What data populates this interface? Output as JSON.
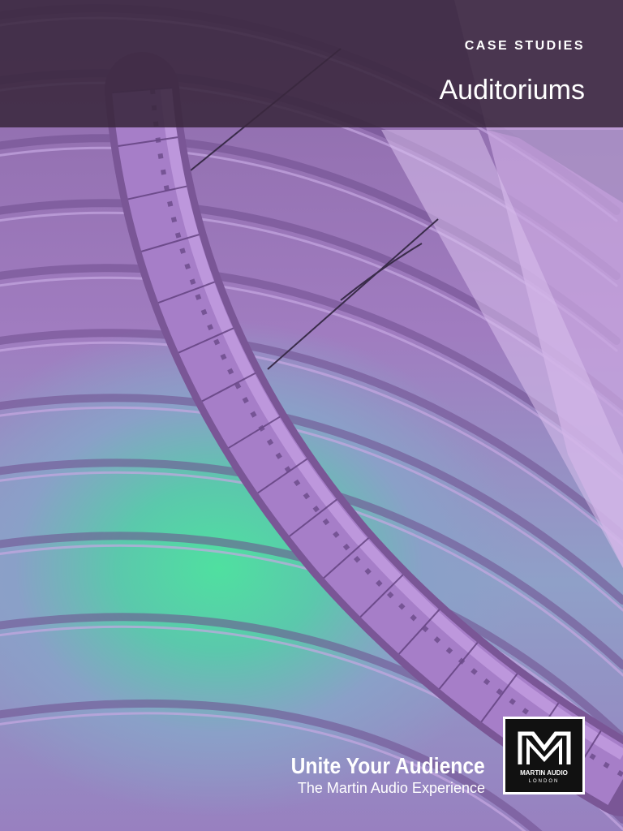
{
  "header": {
    "kicker": "CASE STUDIES",
    "title": "Auditoriums"
  },
  "footer": {
    "tagline": "Unite Your Audience",
    "subtagline": "The Martin Audio Experience"
  },
  "logo": {
    "name": "MARTIN AUDIO",
    "sub": "LONDON"
  }
}
